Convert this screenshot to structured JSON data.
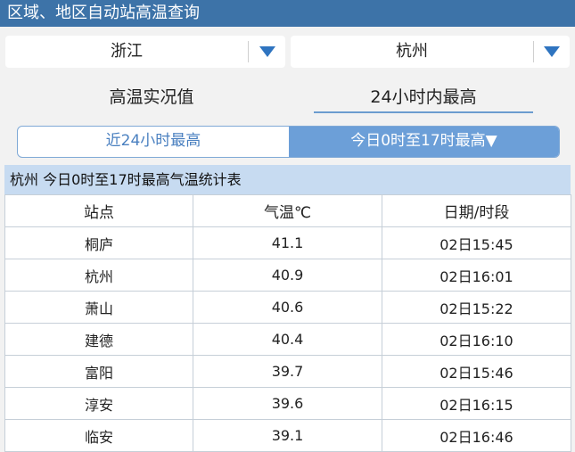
{
  "header": {
    "title": "区域、地区自动站高温查询"
  },
  "filters": {
    "province": "浙江",
    "city": "杭州",
    "arrow_color": "#2f74c0"
  },
  "view_tabs": {
    "tab1": "高温实况值",
    "tab2": "24小时内最高"
  },
  "segment": {
    "left": "近24小时最高",
    "right": "今日0时至17时最高▼"
  },
  "table": {
    "caption": "杭州 今日0时至17时最高气温统计表",
    "headers": [
      "站点",
      "气温℃",
      "日期/时段"
    ],
    "rows": [
      [
        "桐庐",
        "41.1",
        "02日15:45"
      ],
      [
        "杭州",
        "40.9",
        "02日16:01"
      ],
      [
        "萧山",
        "40.6",
        "02日15:22"
      ],
      [
        "建德",
        "40.4",
        "02日16:10"
      ],
      [
        "富阳",
        "39.7",
        "02日15:46"
      ],
      [
        "淳安",
        "39.6",
        "02日16:15"
      ],
      [
        "临安",
        "39.1",
        "02日16:46"
      ]
    ]
  }
}
